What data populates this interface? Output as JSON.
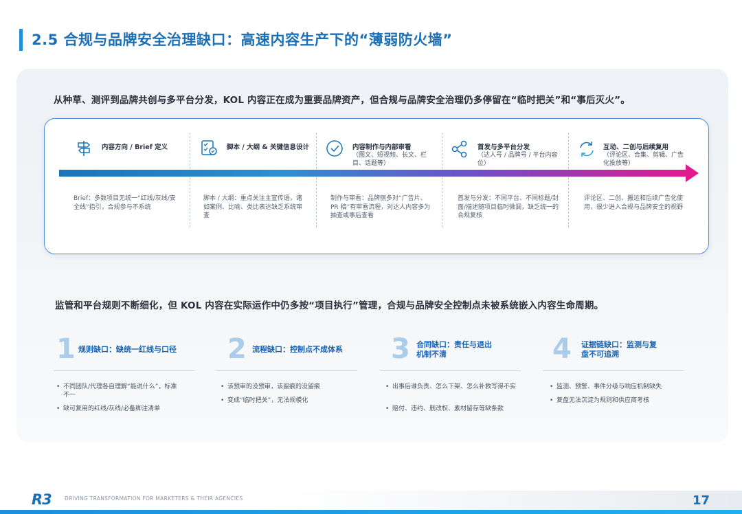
{
  "header": {
    "title": "2.5 合规与品牌安全治理缺口：高速内容生产下的“薄弱防火墙”"
  },
  "lead": "从种草、测评到品牌共创与多平台分发，KOL 内容正在成为重要品牌资产，但合规与品牌安全治理仍多停留在“临时把关”和“事后灭火”。",
  "flow": {
    "stages": [
      {
        "icon": "signpost-icon",
        "title": "内容方向 / Brief 定义",
        "sub": "",
        "desc": "Brief：多数项目无统一“红线/灰线/安全线”指引，合规参与不系统"
      },
      {
        "icon": "checklist-icon",
        "title": "脚本 / 大纲 & 关键信息设计",
        "sub": "",
        "desc": "脚本 / 大纲：重点关注主宣传语，诸如案例、比喻、类比表达缺乏系统审查"
      },
      {
        "icon": "check-circle-icon",
        "title": "内容制作与内部审看",
        "sub": "（图文、短视频、长文、栏目、话题等）",
        "desc": "制作与审看：品牌侧多对“广告片、PR 稿”有审看流程，对达人内容多为抽查或事后查看"
      },
      {
        "icon": "share-icon",
        "title": "首发与多平台分发",
        "sub": "（达人号 / 品牌号 / 平台内容位）",
        "desc": "首发与分发：不同平台、不同标题/封面/描述随项目临时微调，缺乏统一的合规复核"
      },
      {
        "icon": "refresh-icon",
        "title": "互动、二创与后续复用",
        "sub": "（评论区、合集、剪辑、广告化投放等）",
        "desc": "评论区、二创、搬运和后续广告化使用，很少进入合规与品牌安全的视野"
      }
    ]
  },
  "sub_lead": "监管和平台规则不断细化，但 KOL 内容在实际运作中仍多按“项目执行”管理，合规与品牌安全控制点未被系统嵌入内容生命周期。",
  "gaps": [
    {
      "num": "1",
      "title": "规则缺口：缺统一红线与口径",
      "items": [
        "不同团队/代理各自理解“能说什么”，标准不一",
        "缺可复用的红线/灰线/必备脚注清单"
      ]
    },
    {
      "num": "2",
      "title": "流程缺口：控制点不成体系",
      "items": [
        "该预审的没预审，该留痕的没留痕",
        "变成“临时把关”，无法规模化"
      ]
    },
    {
      "num": "3",
      "title": "合同缺口：责任与退出机制不清",
      "items": [
        "出事后谁负责、怎么下架、怎么补救写得不实",
        "赔付、违约、删改权、素材留存等缺条款"
      ]
    },
    {
      "num": "4",
      "title": "证据链缺口：监测与复盘不可追溯",
      "items": [
        "监测、预警、事件分级与响应机制缺失",
        "复盘无法沉淀为规则和供应商考核"
      ]
    }
  ],
  "footer": {
    "logo": "R3",
    "tagline": "DRIVING TRANSFORMATION FOR MARKETERS & THEIR AGENCIES",
    "page": "17"
  },
  "colors": {
    "accent": "#1b6fb5",
    "arrow_start": "#1a75b8",
    "arrow_end": "#e6178c"
  }
}
